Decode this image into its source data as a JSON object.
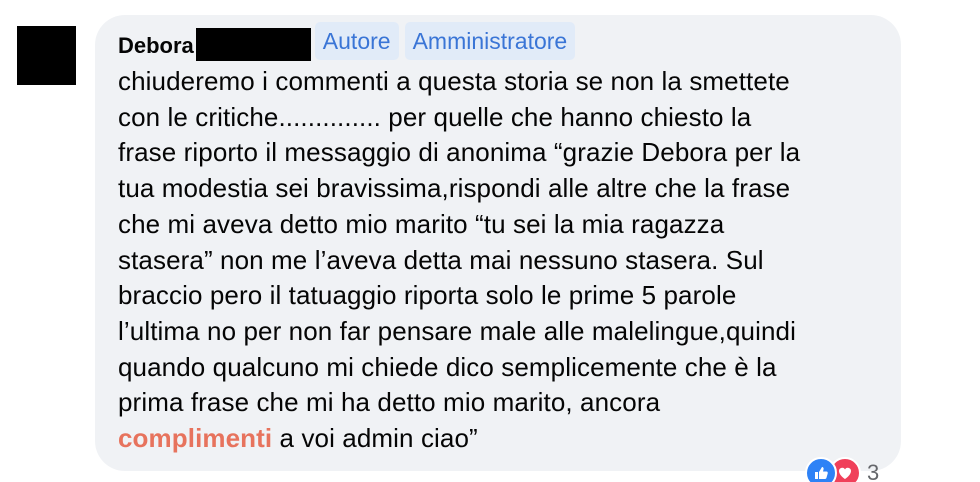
{
  "comment": {
    "author": "Debora",
    "badges": [
      "Autore",
      "Amministratore"
    ],
    "lines": [
      "chiuderemo i commenti a questa storia se non la smettete",
      "con le critiche.............. per quelle che hanno chiesto la",
      "frase riporto il messaggio di anonima “grazie Debora per la",
      "tua modestia sei bravissima,rispondi alle altre che la frase",
      "che mi aveva detto mio marito “tu sei la mia ragazza",
      "stasera” non me l’aveva detta mai nessuno stasera. Sul",
      "braccio pero il tatuaggio riporta solo le prime 5 parole",
      "l’ultima no per non far pensare male alle malelingue,quindi",
      "quando qualcuno mi chiede dico semplicemente che è la",
      "prima frase che mi ha detto mio marito, ancora"
    ],
    "last_line_highlight": "complimenti",
    "last_line_rest": " a voi admin ciao”",
    "reactions": {
      "like_icon": "thumbs-up-icon",
      "love_icon": "heart-icon",
      "count": "3"
    }
  },
  "colors": {
    "bubble": "#f0f2f5",
    "badge_text": "#3a75d6",
    "badge_bg": "#e1ebf8",
    "highlight": "#e7735d"
  }
}
